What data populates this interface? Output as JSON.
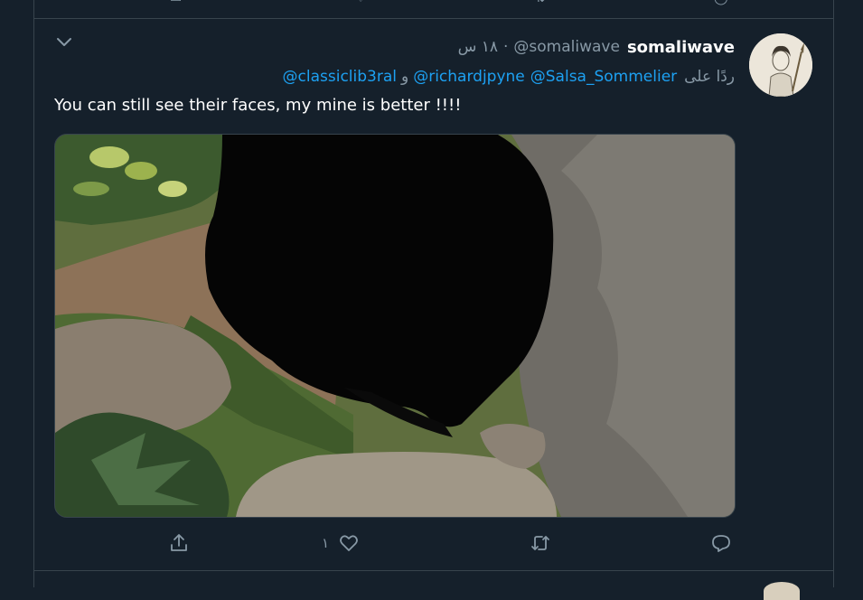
{
  "tweet": {
    "display_name": "somaliwave",
    "handle": "@somaliwave",
    "separator": "·",
    "time": "١٨ س",
    "reply_prefix": "ردًا على",
    "reply_mentions": [
      "@Salsa_Sommelier",
      "@richardjpyne",
      "@classiclib3ral"
    ],
    "reply_and": "و",
    "text": "You can still see their faces, my mine is better !!!!",
    "like_count": "١"
  },
  "actions": {
    "share_icon": "share-icon",
    "like_icon": "heart-icon",
    "retweet_icon": "retweet-icon",
    "reply_icon": "reply-icon"
  },
  "colors": {
    "background": "#15202b",
    "border": "#38444d",
    "secondary_text": "#8899a6",
    "link": "#1da1f2"
  }
}
